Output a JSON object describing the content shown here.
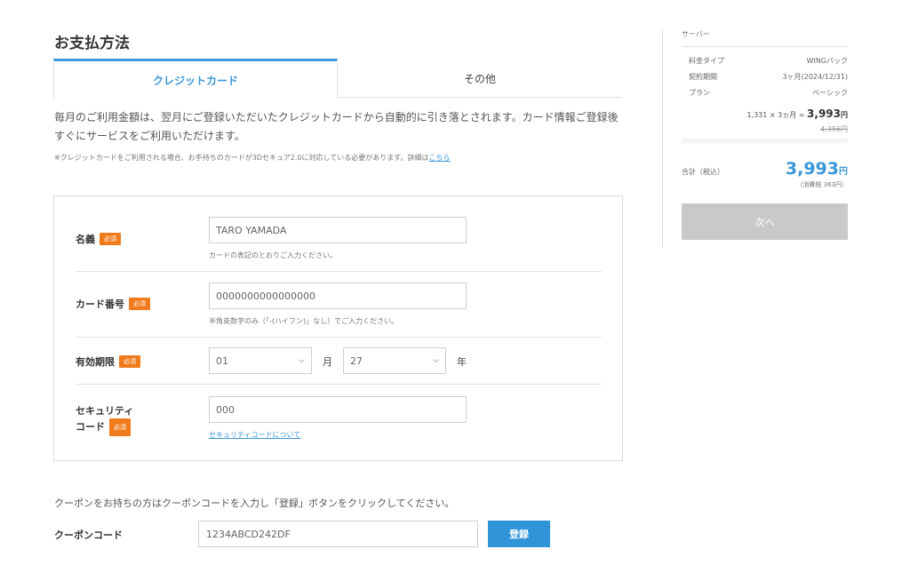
{
  "page": {
    "title": "お支払方法"
  },
  "tabs": [
    {
      "label": "クレジットカード"
    },
    {
      "label": "その他"
    }
  ],
  "intro": {
    "line1": "毎月のご利用金額は、翌月にご登録いただいたクレジットカードから自動的に引き落とされます。カード情報ご登録後",
    "line2": "すぐにサービスをご利用いただけます。",
    "note": "※クレジットカードをご利用される場合、お手持ちのカードが3Dセキュア2.0に対応している必要があります。詳細は",
    "note_link": "こちら"
  },
  "required_badge": "必須",
  "form": {
    "name": {
      "label": "名義",
      "value": "TARO YAMADA",
      "hint": "カードの表記のとおりご入力ください。"
    },
    "card": {
      "label": "カード番号",
      "value": "0000000000000000",
      "hint": "半角英数字のみ（「-(ハイフン)」なし）でご入力ください。"
    },
    "expiry": {
      "label": "有効期限",
      "month": "01",
      "month_unit": "月",
      "year": "27",
      "year_unit": "年"
    },
    "security": {
      "label_line1": "セキュリティ",
      "label_line2": "コード",
      "value": "000",
      "link": "セキュリティコードについて"
    }
  },
  "coupon": {
    "text": "クーポンをお持ちの方はクーポンコードを入力し「登録」ボタンをクリックしてください。",
    "label": "クーポンコード",
    "value": "1234ABCD242DF",
    "button": "登録"
  },
  "summary": {
    "section": "サーバー",
    "rows": [
      {
        "key": "料金タイプ",
        "value": "WINGパック"
      },
      {
        "key": "契約期間",
        "value": "3ヶ月(2024/12/31)"
      },
      {
        "key": "プラン",
        "value": "ベーシック"
      }
    ],
    "calc": "1,331 × 3ヵ月 =",
    "subtotal": "3,993",
    "yen": "円",
    "original": "4,356円",
    "total_label": "合計（税込）",
    "total": "3,993",
    "total_yen": "円",
    "tax": "（消費税 363円）",
    "next": "次へ"
  },
  "colors": {
    "accent": "#3b97d8",
    "required": "#f07b1d",
    "button": "#2f93d8",
    "disabled": "#c9c9c9"
  }
}
